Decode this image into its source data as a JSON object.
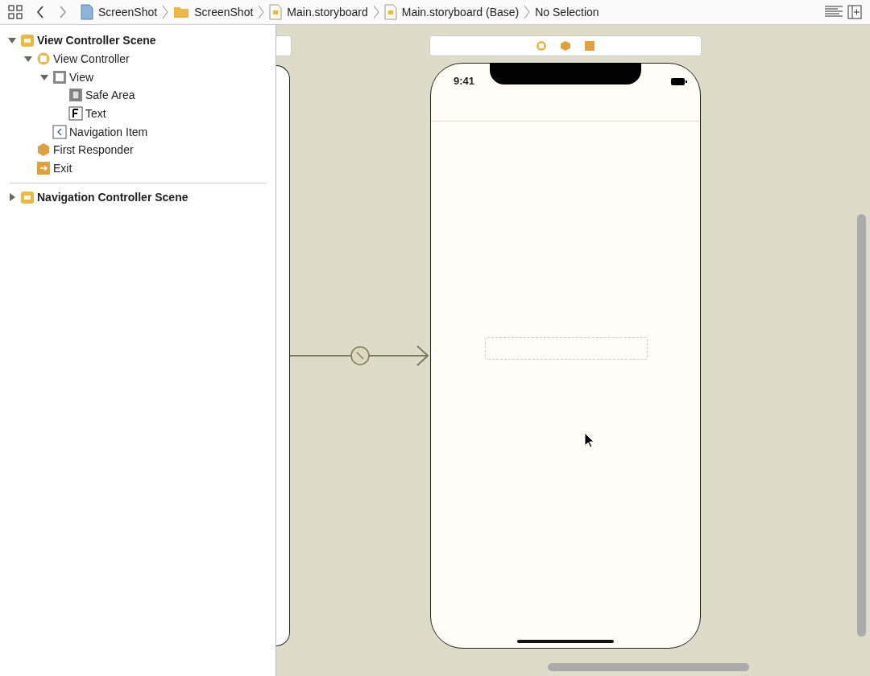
{
  "breadcrumbs": [
    {
      "label": "ScreenShot",
      "kind": "project"
    },
    {
      "label": "ScreenShot",
      "kind": "folder"
    },
    {
      "label": "Main.storyboard",
      "kind": "storyboard"
    },
    {
      "label": "Main.storyboard (Base)",
      "kind": "storyboard"
    },
    {
      "label": "No Selection",
      "kind": "none"
    }
  ],
  "outline": [
    {
      "label": "View Controller Scene",
      "kind": "scene",
      "expanded": true,
      "children": [
        {
          "label": "View Controller",
          "kind": "controller",
          "expanded": true,
          "children": [
            {
              "label": "View",
              "kind": "view",
              "expanded": true,
              "children": [
                {
                  "label": "Safe Area",
                  "kind": "safearea"
                },
                {
                  "label": "Text",
                  "kind": "text"
                }
              ]
            },
            {
              "label": "Navigation Item",
              "kind": "navitem"
            }
          ]
        },
        {
          "label": "First Responder",
          "kind": "responder"
        },
        {
          "label": "Exit",
          "kind": "exit"
        }
      ]
    },
    {
      "label": "Navigation Controller Scene",
      "kind": "scene",
      "expanded": false
    }
  ],
  "phone": {
    "time": "9:41"
  }
}
